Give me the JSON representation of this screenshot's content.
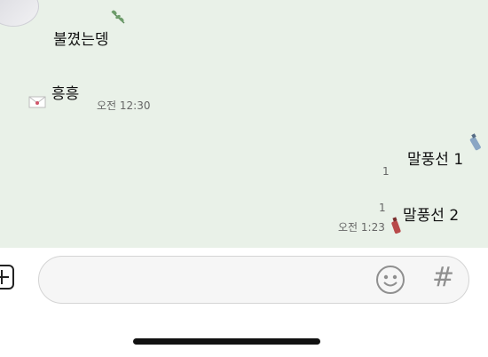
{
  "messages": [
    {
      "text": "불꼈는뎅"
    },
    {
      "text": "흥흥",
      "time": "오전 12:30"
    },
    {
      "text": "말풍선 1",
      "unread": "1"
    },
    {
      "text": "말풍선 2",
      "unread": "1",
      "time": "오전 1:23"
    }
  ],
  "input": {
    "placeholder": "",
    "plus_icon": "plus-icon",
    "emoji_icon": "smiley-icon",
    "hash_icon": "hashtag-icon",
    "hash_glyph": "#"
  },
  "colors": {
    "chat_background": "#e9f1e8",
    "input_background": "#f6f6f6",
    "icon_gray": "#9a9a9a"
  }
}
